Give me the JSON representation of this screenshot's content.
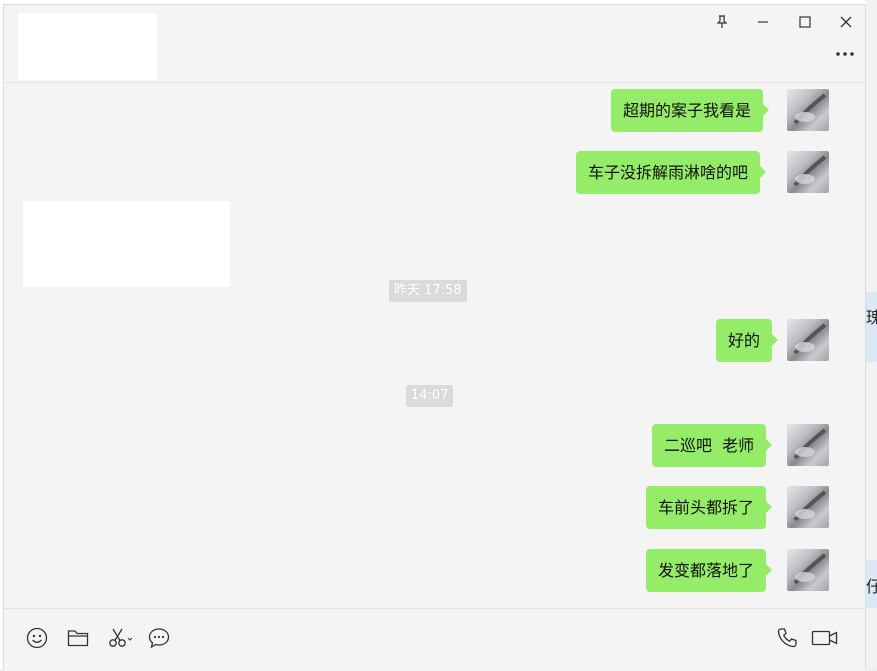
{
  "window_controls": {
    "pin_icon": "pin-icon",
    "minimize_icon": "minimize-icon",
    "maximize_icon": "maximize-icon",
    "close_icon": "close-icon",
    "more_icon": "more-icon"
  },
  "messages": [
    {
      "type": "sent",
      "text": "超期的案子我看是"
    },
    {
      "type": "sent",
      "text": "车子没拆解雨淋啥的吧"
    },
    {
      "type": "received",
      "text": ""
    },
    {
      "type": "time",
      "text": "昨天 17:58"
    },
    {
      "type": "sent",
      "text": "好的"
    },
    {
      "type": "time",
      "text": "14:07"
    },
    {
      "type": "sent",
      "text": "二巡吧  老师"
    },
    {
      "type": "sent",
      "text": "车前头都拆了"
    },
    {
      "type": "sent",
      "text": "发变都落地了"
    }
  ],
  "background_window": {
    "partial_text_1": "瑰",
    "partial_text_2": "仔"
  },
  "toolbar": {
    "left_icons": [
      "emoji-icon",
      "folder-icon",
      "scissors-icon",
      "chat-bubble-icon"
    ],
    "right_icons": [
      "phone-icon",
      "video-icon"
    ]
  },
  "colors": {
    "bubble_sent": "#95ec69",
    "window_bg": "#f4f4f4",
    "time_label_bg": "#dadada"
  }
}
